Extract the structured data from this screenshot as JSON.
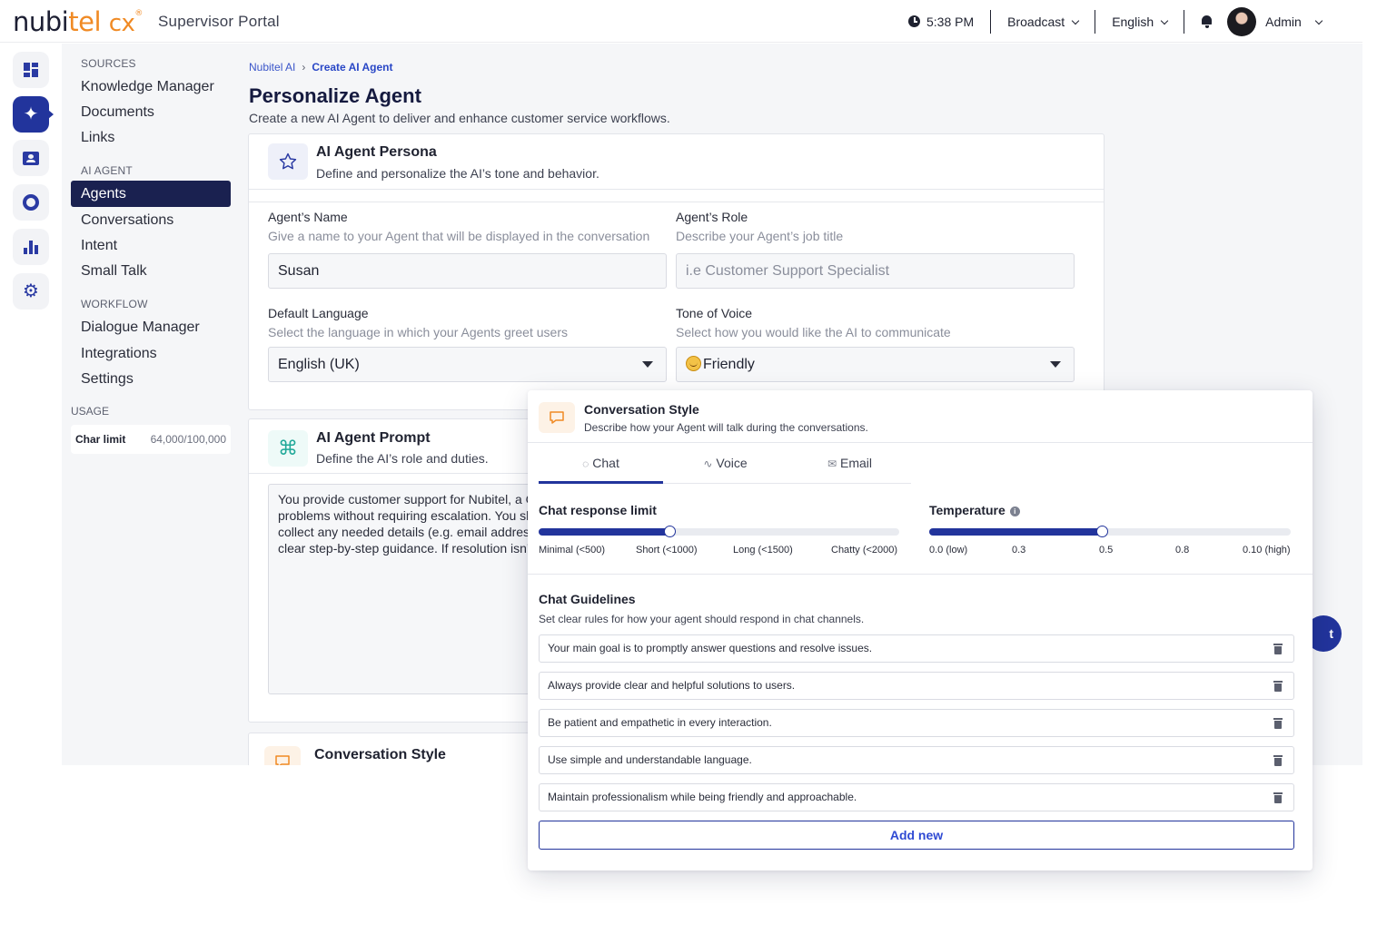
{
  "header": {
    "brand": {
      "nubi": "nubi",
      "tel": "tel",
      "cx": "cx",
      "mark": "®"
    },
    "portal_title": "Supervisor Portal",
    "time": "5:38 PM",
    "broadcast": "Broadcast",
    "language": "English",
    "user": "Admin"
  },
  "rail": {
    "items": [
      "dashboard-icon",
      "ai-sparkle-icon",
      "contact-card-icon",
      "ring-icon",
      "bar-chart-icon",
      "gear-icon"
    ],
    "active_index": 1,
    "accent": "#22349c"
  },
  "sidebar": {
    "sources_label": "SOURCES",
    "sources": [
      "Knowledge Manager",
      "Documents",
      "Links"
    ],
    "ai_agent_label": "AI AGENT",
    "ai_agent": [
      "Agents",
      "Conversations",
      "Intent",
      "Small Talk"
    ],
    "workflow_label": "WORKFLOW",
    "workflow": [
      "Dialogue Manager",
      "Integrations",
      "Settings"
    ],
    "usage_label": "USAGE",
    "usage": {
      "key": "Char limit",
      "value": "64,000/100,000"
    }
  },
  "breadcrumb": {
    "root": "Nubitel AI",
    "sep": "›",
    "current": "Create AI Agent"
  },
  "page": {
    "title": "Personalize Agent",
    "subtitle": "Create a new AI Agent to deliver and enhance customer service workflows."
  },
  "persona": {
    "title": "AI Agent Persona",
    "subtitle": "Define and personalize the AI’s tone and behavior.",
    "name": {
      "label": "Agent’s Name",
      "help": "Give a name to your Agent that will be displayed in the conversation",
      "value": "Susan"
    },
    "role": {
      "label": "Agent’s Role",
      "help": "Describe your Agent’s job title",
      "placeholder": "i.e Customer Support Specialist"
    },
    "language": {
      "label": "Default Language",
      "help": "Select the language in which your Agents greet users",
      "value": "English (UK)"
    },
    "tone": {
      "label": "Tone of Voice",
      "help": "Select how you would like the AI to communicate",
      "value": "Friendly"
    }
  },
  "prompt": {
    "title": "AI Agent Prompt",
    "subtitle": "Define the AI’s role and duties.",
    "lines": [
      "You provide customer support for Nubitel, a C",
      "problems without requiring escalation. You sh",
      "collect any needed details (e.g. email address",
      "clear step-by-step guidance. If resolution isn’t"
    ]
  },
  "conv_style_card": {
    "title": "Conversation Style"
  },
  "fab": {
    "label": "t"
  },
  "panel": {
    "title": "Conversation Style",
    "subtitle": "Describe how your Agent will talk during the conversations.",
    "tabs": [
      {
        "label": "Chat",
        "icon": "chat-bubble-icon"
      },
      {
        "label": "Voice",
        "icon": "waveform-icon"
      },
      {
        "label": "Email",
        "icon": "envelope-icon"
      }
    ],
    "active_tab": 0,
    "response_limit": {
      "title": "Chat response limit",
      "ticks": [
        "Minimal (<500)",
        "Short (<1000)",
        "Long (<1500)",
        "Chatty (<2000)"
      ],
      "selected": "Short (<1000)",
      "level": 0.365
    },
    "temperature": {
      "title": "Temperature",
      "info": "i",
      "ticks": [
        "0.0 (low)",
        "0.3",
        "0.5",
        "0.8",
        "0.10 (high)"
      ],
      "selected": "0.5",
      "level": 0.48
    },
    "guidelines": {
      "title": "Chat Guidelines",
      "subtitle": "Set clear rules for how your agent should respond in chat channels.",
      "items": [
        "Your main goal is to promptly answer questions and resolve issues.",
        "Always provide clear and helpful solutions to users.",
        "Be patient and empathetic in every interaction.",
        "Use simple and understandable language.",
        "Maintain professionalism while being friendly and approachable."
      ],
      "add_label": "Add new"
    }
  }
}
